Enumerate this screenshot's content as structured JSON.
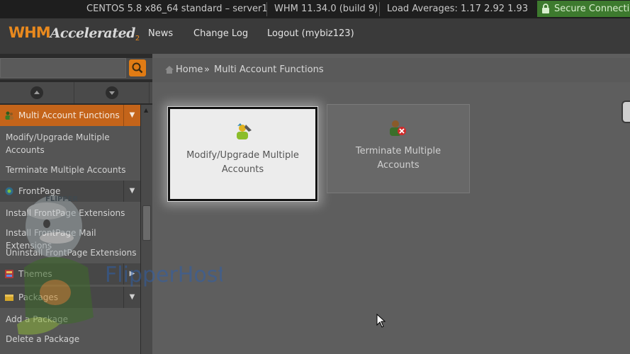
{
  "status_bar": {
    "server": "CENTOS 5.8 x86_64 standard – server1",
    "version": "WHM 11.34.0 (build 9)",
    "load": "Load Averages: 1.17 2.92 1.93",
    "secure": "Secure Connection"
  },
  "header": {
    "logo_main": "WHM",
    "logo_sub": "Accelerated",
    "logo_num": "2",
    "nav": [
      "News",
      "Change Log",
      "Logout (mybiz123)"
    ]
  },
  "search": {
    "placeholder": ""
  },
  "breadcrumb": {
    "home": "Home",
    "separator": "»",
    "current": "Multi Account Functions"
  },
  "sidebar": {
    "sections": [
      {
        "title": "Multi Account Functions",
        "items": [
          "Modify/Upgrade Multiple Accounts",
          "Terminate Multiple Accounts"
        ]
      },
      {
        "title": "FrontPage",
        "items": [
          "Install FrontPage Extensions",
          "Install FrontPage Mail Extensions",
          "Uninstall FrontPage Extensions"
        ]
      },
      {
        "title": "Themes",
        "items": []
      },
      {
        "title": "Packages",
        "items": [
          "Add a Package",
          "Delete a Package"
        ]
      }
    ]
  },
  "cards": [
    {
      "label": "Modify/Upgrade Multiple Accounts",
      "selected": true
    },
    {
      "label": "Terminate Multiple Accounts",
      "selected": false
    }
  ],
  "watermark": {
    "brand": "FlipperHost",
    "mascot_label": "FLIPPER"
  },
  "colors": {
    "accent": "#c4641a",
    "secure_green": "#3d7a2e",
    "orange_btn": "#e07b14"
  }
}
